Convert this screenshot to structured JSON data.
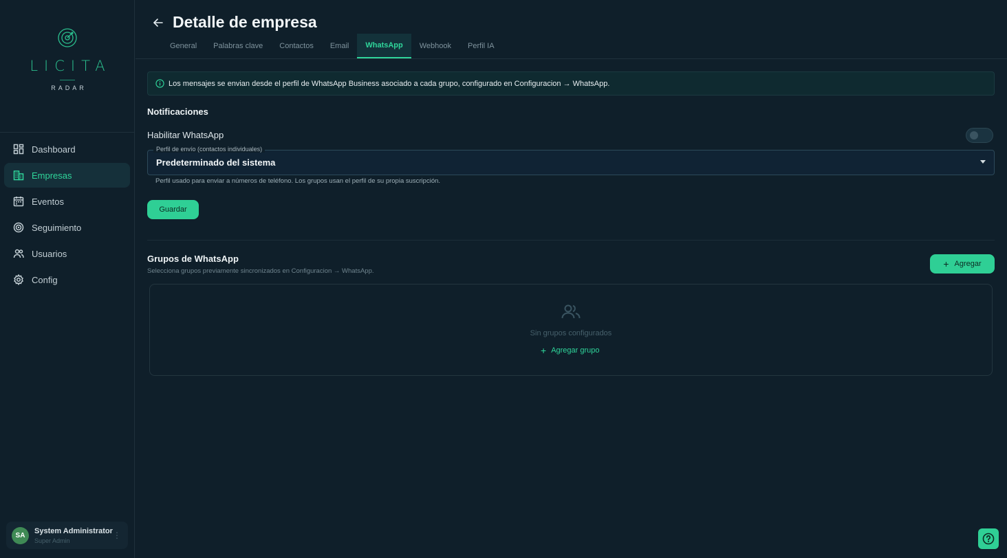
{
  "brand": {
    "name": "LICITA",
    "subtitle": "RADAR",
    "accent": "#2fd69b"
  },
  "sidebar": {
    "items": [
      {
        "label": "Dashboard",
        "icon": "dashboard-icon",
        "active": false
      },
      {
        "label": "Empresas",
        "icon": "building-icon",
        "active": true
      },
      {
        "label": "Eventos",
        "icon": "calendar-icon",
        "active": false
      },
      {
        "label": "Seguimiento",
        "icon": "radar-icon",
        "active": false
      },
      {
        "label": "Usuarios",
        "icon": "users-icon",
        "active": false
      },
      {
        "label": "Config",
        "icon": "gear-icon",
        "active": false
      }
    ],
    "user": {
      "initials": "SA",
      "name": "System Administrator",
      "role": "Super Admin"
    }
  },
  "header": {
    "title": "Detalle de empresa",
    "tabs": [
      {
        "label": "General",
        "active": false
      },
      {
        "label": "Palabras clave",
        "active": false
      },
      {
        "label": "Contactos",
        "active": false
      },
      {
        "label": "Email",
        "active": false
      },
      {
        "label": "WhatsApp",
        "active": true
      },
      {
        "label": "Webhook",
        "active": false
      },
      {
        "label": "Perfil IA",
        "active": false
      }
    ]
  },
  "info": {
    "text": "Los mensajes se envian desde el perfil de WhatsApp Business asociado a cada grupo, configurado en Configuracion → WhatsApp."
  },
  "notifications": {
    "title": "Notificaciones",
    "enable_label": "Habilitar WhatsApp",
    "enabled": false,
    "profile_select": {
      "label": "Perfil de envío (contactos individuales)",
      "value": "Predeterminado del sistema",
      "helper": "Perfil usado para enviar a números de teléfono. Los grupos usan el perfil de su propia suscripción."
    },
    "save_label": "Guardar"
  },
  "groups": {
    "title": "Grupos de WhatsApp",
    "subtitle": "Selecciona grupos previamente sincronizados en Configuracion → WhatsApp.",
    "add_label": "Agregar",
    "empty_text": "Sin grupos configurados",
    "add_group_label": "Agregar grupo"
  }
}
